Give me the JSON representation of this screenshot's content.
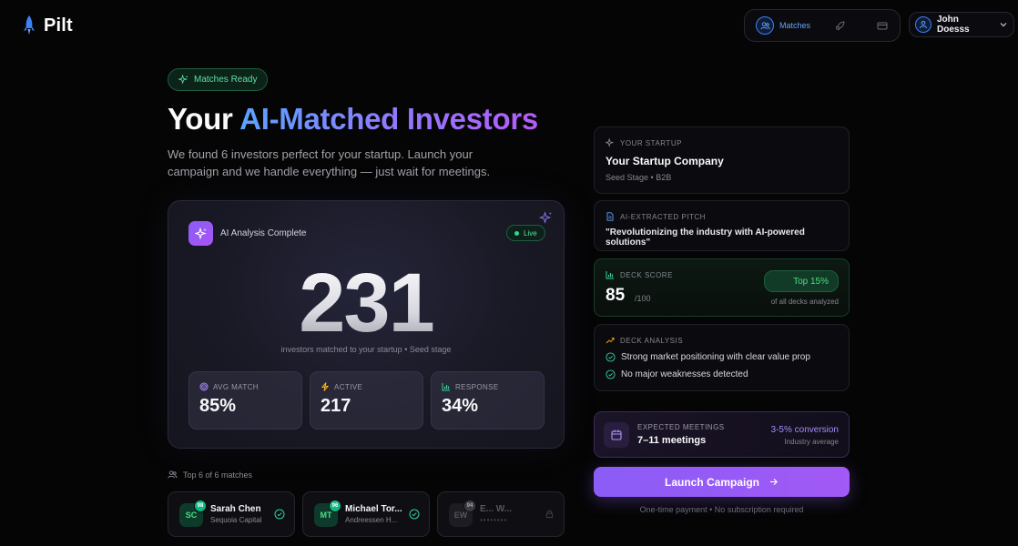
{
  "brand": {
    "name": "Pilt"
  },
  "nav": {
    "matches_label": "Matches"
  },
  "user": {
    "name": "John Doesss"
  },
  "hero": {
    "badge": "Matches Ready",
    "title_plain": "Your ",
    "title_accent": "AI-Matched Investors",
    "subtitle": "We found 6 investors perfect for your startup. Launch your campaign and we handle everything — just wait for meetings."
  },
  "analysis": {
    "title": "AI Analysis Complete",
    "live": "Live",
    "count": "231",
    "caption": "investors matched to your startup • Seed stage",
    "stats": [
      {
        "label": "AVG MATCH",
        "value": "85%",
        "icon": "target-icon",
        "color": "#a78bfa"
      },
      {
        "label": "ACTIVE",
        "value": "217",
        "icon": "bolt-icon",
        "color": "#fbbf24"
      },
      {
        "label": "RESPONSE",
        "value": "34%",
        "icon": "bar-chart-icon",
        "color": "#34d399"
      }
    ]
  },
  "matches": {
    "heading": "Top 6 of 6 matches",
    "items": [
      {
        "initials": "SC",
        "score": "98",
        "name": "Sarah Chen",
        "firm": "Sequoia Capital",
        "locked": false
      },
      {
        "initials": "MT",
        "score": "96",
        "name": "Michael Tor...",
        "firm": "Andreessen H...",
        "locked": false
      },
      {
        "initials": "EW",
        "score": "94",
        "name": "E... W...",
        "firm": "••••••••",
        "locked": true
      }
    ]
  },
  "startup": {
    "label": "YOUR STARTUP",
    "name": "Your Startup Company",
    "meta": "Seed Stage • B2B"
  },
  "pitch": {
    "label": "AI-EXTRACTED PITCH",
    "quote": "\"Revolutionizing the industry with AI-powered solutions\""
  },
  "deck_score": {
    "label": "DECK SCORE",
    "value": "85",
    "max": "/100",
    "badge": "Top 15%",
    "sub": "of all decks analyzed"
  },
  "deck_analysis": {
    "label": "DECK ANALYSIS",
    "items": [
      "Strong market positioning with clear value prop",
      "No major weaknesses detected"
    ]
  },
  "meetings": {
    "label": "EXPECTED MEETINGS",
    "value": "7–11 meetings",
    "conversion": "3-5% conversion",
    "note": "Industry average"
  },
  "cta": {
    "label": "Launch Campaign",
    "note": "One-time payment • No subscription required"
  },
  "colors": {
    "accent": "#8b5cf6",
    "success": "#34d399",
    "blue": "#3b82f6"
  }
}
